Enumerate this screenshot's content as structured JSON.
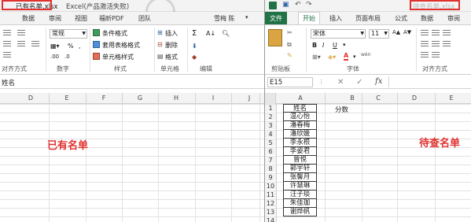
{
  "left_window": {
    "title_filename": "已有名单.xlsx",
    "title_app": "Excel(产品激活失败)",
    "tabs": [
      "数据",
      "审阅",
      "视图",
      "福昕PDF",
      "团队"
    ],
    "user": "雪梅 陈",
    "ribbon": {
      "number_format": "常规",
      "percent": "%",
      "comma": ",",
      "cond_format": "条件格式",
      "table_format": "套用表格格式",
      "cell_style": "单元格样式",
      "insert": "插入",
      "delete": "删除",
      "format": "格式",
      "sum": "Σ",
      "group_align": "对齐方式",
      "group_number": "数字",
      "group_styles": "样式",
      "group_cells": "单元格",
      "group_edit": "编辑"
    },
    "formula_value": "姓名",
    "columns": [
      "D",
      "E",
      "F",
      "G",
      "H",
      "I",
      "J"
    ],
    "big_label": "已有名单"
  },
  "right_window": {
    "title_filename": "待查名单.xlsx",
    "tabs": {
      "file": "文件",
      "home": "开始",
      "insert": "插入",
      "layout": "页面布局",
      "formulas": "公式",
      "data": "数据",
      "review": "审阅"
    },
    "ribbon": {
      "font_name": "宋体",
      "font_size": "11",
      "bold": "B",
      "italic": "I",
      "underline": "U",
      "wen": "wén",
      "font_a": "A",
      "group_clipboard": "剪贴板",
      "group_font": "字体",
      "group_align": "对齐方式"
    },
    "name_box": "E15",
    "fx": "fx",
    "cancel_mark": "✕",
    "enter_mark": "✓",
    "columns": [
      "A",
      "B",
      "C",
      "D",
      "E"
    ],
    "header_cell": "姓名",
    "score_header": "分数",
    "row_numbers": [
      "1",
      "2",
      "3",
      "4",
      "5",
      "6",
      "7",
      "8",
      "9",
      "10",
      "11",
      "12",
      "13",
      "14"
    ],
    "names": [
      "温心怡",
      "潘春梅",
      "潘欣媛",
      "李永根",
      "李姿君",
      "曾悦",
      "郭宇轩",
      "张馨月",
      "许慧琳",
      "汪子琰",
      "朱佳珈",
      "谢烨帆"
    ],
    "big_label": "待查名单"
  },
  "colors": {
    "excel_green": "#217346",
    "highlight_red": "#e0312f"
  }
}
